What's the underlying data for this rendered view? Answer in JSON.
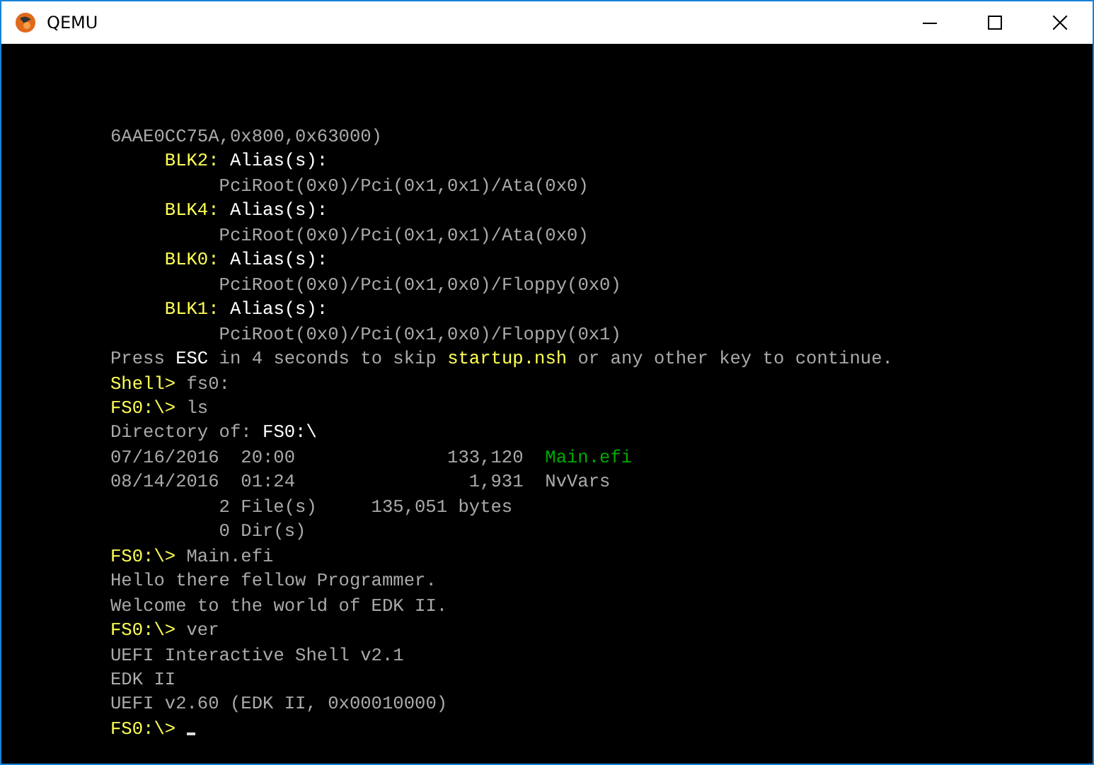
{
  "window": {
    "title": "QEMU"
  },
  "console": {
    "lines": [
      {
        "kind": "text",
        "segments": [
          {
            "text": "6AAE0CC75A,0x800,0x63000)",
            "color": "#aaaaaa"
          }
        ]
      },
      {
        "kind": "alias",
        "segments": [
          {
            "text": "BLK2:",
            "color": "#ffff55"
          },
          {
            "text": " Alias(s):",
            "color": "#ffffff"
          }
        ]
      },
      {
        "kind": "path",
        "segments": [
          {
            "text": "PciRoot(0x0)/Pci(0x1,0x1)/Ata(0x0)",
            "color": "#aaaaaa"
          }
        ]
      },
      {
        "kind": "alias",
        "segments": [
          {
            "text": "BLK4:",
            "color": "#ffff55"
          },
          {
            "text": " Alias(s):",
            "color": "#ffffff"
          }
        ]
      },
      {
        "kind": "path",
        "segments": [
          {
            "text": "PciRoot(0x0)/Pci(0x1,0x1)/Ata(0x0)",
            "color": "#aaaaaa"
          }
        ]
      },
      {
        "kind": "alias",
        "segments": [
          {
            "text": "BLK0:",
            "color": "#ffff55"
          },
          {
            "text": " Alias(s):",
            "color": "#ffffff"
          }
        ]
      },
      {
        "kind": "path",
        "segments": [
          {
            "text": "PciRoot(0x0)/Pci(0x1,0x0)/Floppy(0x0)",
            "color": "#aaaaaa"
          }
        ]
      },
      {
        "kind": "alias",
        "segments": [
          {
            "text": "BLK1:",
            "color": "#ffff55"
          },
          {
            "text": " Alias(s):",
            "color": "#ffffff"
          }
        ]
      },
      {
        "kind": "path",
        "segments": [
          {
            "text": "PciRoot(0x0)/Pci(0x1,0x0)/Floppy(0x1)",
            "color": "#aaaaaa"
          }
        ]
      },
      {
        "kind": "text",
        "segments": [
          {
            "text": "Press ",
            "color": "#aaaaaa"
          },
          {
            "text": "ESC",
            "color": "#ffffff"
          },
          {
            "text": " in 4 seconds to skip ",
            "color": "#aaaaaa"
          },
          {
            "text": "startup.nsh",
            "color": "#ffff55"
          },
          {
            "text": " or any other key to continue.",
            "color": "#aaaaaa"
          }
        ]
      },
      {
        "kind": "text",
        "segments": [
          {
            "text": "Shell>",
            "color": "#ffff55"
          },
          {
            "text": " fs0:",
            "color": "#aaaaaa"
          }
        ]
      },
      {
        "kind": "text",
        "segments": [
          {
            "text": "FS0:\\>",
            "color": "#ffff55"
          },
          {
            "text": " ls",
            "color": "#aaaaaa"
          }
        ]
      },
      {
        "kind": "text",
        "segments": [
          {
            "text": "Directory of: ",
            "color": "#aaaaaa"
          },
          {
            "text": "FS0:\\",
            "color": "#ffffff"
          }
        ]
      },
      {
        "kind": "dir_entry",
        "date": "07/16/2016",
        "time": "20:00",
        "size": "133,120",
        "name": "Main.efi",
        "color": "#00aa00"
      },
      {
        "kind": "dir_entry",
        "date": "08/14/2016",
        "time": "01:24",
        "size": "1,931",
        "name": "NvVars",
        "color": "#aaaaaa"
      },
      {
        "kind": "summary",
        "count": "2 File(s)",
        "total": "135,051 bytes"
      },
      {
        "kind": "summary",
        "count": "0 Dir(s)"
      },
      {
        "kind": "text",
        "segments": [
          {
            "text": "FS0:\\>",
            "color": "#ffff55"
          },
          {
            "text": " Main.efi",
            "color": "#aaaaaa"
          }
        ]
      },
      {
        "kind": "text",
        "segments": [
          {
            "text": "Hello there fellow Programmer.",
            "color": "#aaaaaa"
          }
        ]
      },
      {
        "kind": "text",
        "segments": [
          {
            "text": "Welcome to the world of EDK II.",
            "color": "#aaaaaa"
          }
        ]
      },
      {
        "kind": "text",
        "segments": [
          {
            "text": "FS0:\\>",
            "color": "#ffff55"
          },
          {
            "text": " ver",
            "color": "#aaaaaa"
          }
        ]
      },
      {
        "kind": "text",
        "segments": [
          {
            "text": "UEFI Interactive Shell v2.1",
            "color": "#aaaaaa"
          }
        ]
      },
      {
        "kind": "text",
        "segments": [
          {
            "text": "EDK II",
            "color": "#aaaaaa"
          }
        ]
      },
      {
        "kind": "text",
        "segments": [
          {
            "text": "UEFI v2.60 (EDK II, 0x00010000)",
            "color": "#aaaaaa"
          }
        ]
      },
      {
        "kind": "text",
        "cursor": true,
        "segments": [
          {
            "text": "FS0:\\>",
            "color": "#ffff55"
          }
        ]
      }
    ]
  }
}
